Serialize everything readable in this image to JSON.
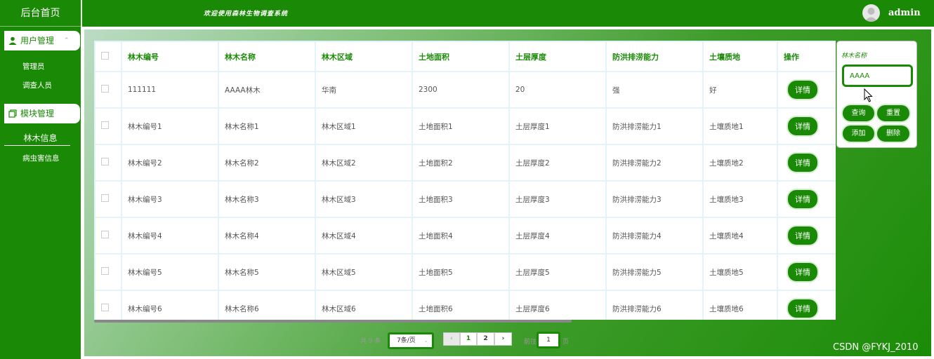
{
  "sidebar": {
    "brand": "后台首页",
    "group1": "用户管理",
    "group1_items": [
      "管理员",
      "调查人员"
    ],
    "group2": "模块管理",
    "group2_items": [
      "林木信息",
      "病虫害信息"
    ]
  },
  "header": {
    "welcome": "欢迎使用森林生物调查系统",
    "username": "admin"
  },
  "table": {
    "columns": [
      "林木编号",
      "林木名称",
      "林木区域",
      "土地面积",
      "土层厚度",
      "防洪排涝能力",
      "土壤质地",
      "操作"
    ],
    "action_label": "详情",
    "rows": [
      [
        "111111",
        "AAAA林木",
        "华南",
        "2300",
        "20",
        "强",
        "好"
      ],
      [
        "林木编号1",
        "林木名称1",
        "林木区域1",
        "土地面积1",
        "土层厚度1",
        "防洪排涝能力1",
        "土壤质地1"
      ],
      [
        "林木编号2",
        "林木名称2",
        "林木区域2",
        "土地面积2",
        "土层厚度2",
        "防洪排涝能力2",
        "土壤质地2"
      ],
      [
        "林木编号3",
        "林木名称3",
        "林木区域3",
        "土地面积3",
        "土层厚度3",
        "防洪排涝能力3",
        "土壤质地3"
      ],
      [
        "林木编号4",
        "林木名称4",
        "林木区域4",
        "土地面积4",
        "土层厚度4",
        "防洪排涝能力4",
        "土壤质地4"
      ],
      [
        "林木编号5",
        "林木名称5",
        "林木区域5",
        "土地面积5",
        "土层厚度5",
        "防洪排涝能力5",
        "土壤质地5"
      ],
      [
        "林木编号6",
        "林木名称6",
        "林木区域6",
        "土地面积6",
        "土层厚度6",
        "防洪排涝能力6",
        "土壤质地6"
      ]
    ]
  },
  "search": {
    "label": "林木名称",
    "value": "AAAA",
    "query": "查询",
    "reset": "重置",
    "add": "添加",
    "delete": "删除"
  },
  "pagination": {
    "total": "共 9 条",
    "page_size": "7条/页",
    "pages": [
      "1",
      "2"
    ],
    "goto_prefix": "前往",
    "goto_value": "1",
    "goto_suffix": "页"
  },
  "watermark": "CSDN @FYKJ_2010",
  "colors": {
    "primary": "#1a8a06",
    "header_text": "#ffffff"
  }
}
